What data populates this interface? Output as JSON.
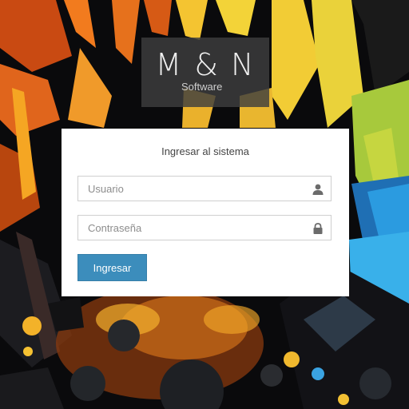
{
  "brand": {
    "title": "M & N",
    "subtitle": "Software"
  },
  "login": {
    "heading": "Ingresar al sistema",
    "username": {
      "placeholder": "Usuario",
      "value": "",
      "icon": "user-icon"
    },
    "password": {
      "placeholder": "Contraseña",
      "value": "",
      "icon": "lock-icon"
    },
    "submit_label": "Ingresar"
  },
  "colors": {
    "accent": "#3c8dbc",
    "panel": "#ffffff",
    "logo_box": "#3e3e3e"
  }
}
